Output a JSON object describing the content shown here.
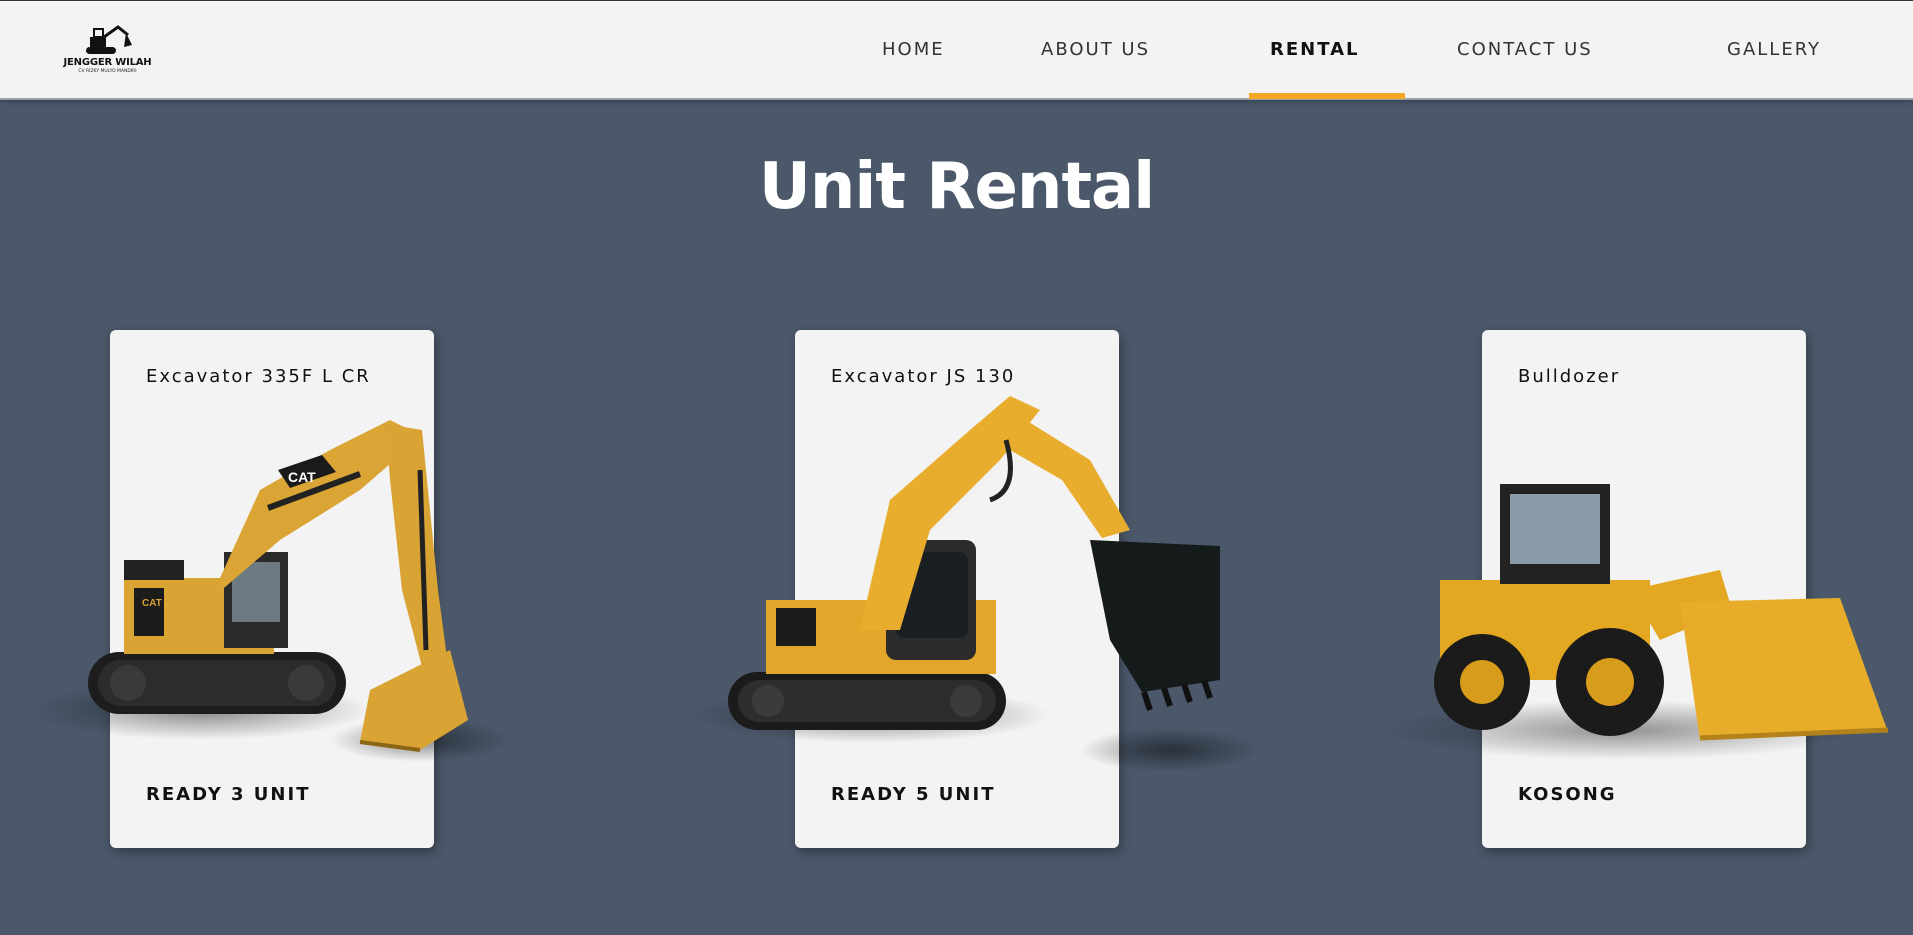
{
  "brand": {
    "name": "JENGGER WILAH",
    "subtitle": "CV RIZKY MULYO MANDIRI"
  },
  "nav": {
    "items": [
      {
        "label": "HOME"
      },
      {
        "label": "ABOUT US"
      },
      {
        "label": "RENTAL"
      },
      {
        "label": "CONTACT US"
      },
      {
        "label": "GALLERY"
      }
    ],
    "active": "RENTAL",
    "accent_color": "#f5a623"
  },
  "page": {
    "title": "Unit Rental",
    "background": "#4b586a"
  },
  "cards": [
    {
      "title": "Excavator 335F L CR",
      "status": "READY 3 UNIT",
      "image": "excavator-cat-335f"
    },
    {
      "title": "Excavator JS 130",
      "status": "READY 5 UNIT",
      "image": "excavator-js130"
    },
    {
      "title": "Bulldozer",
      "status": "KOSONG",
      "image": "wheel-loader"
    }
  ]
}
